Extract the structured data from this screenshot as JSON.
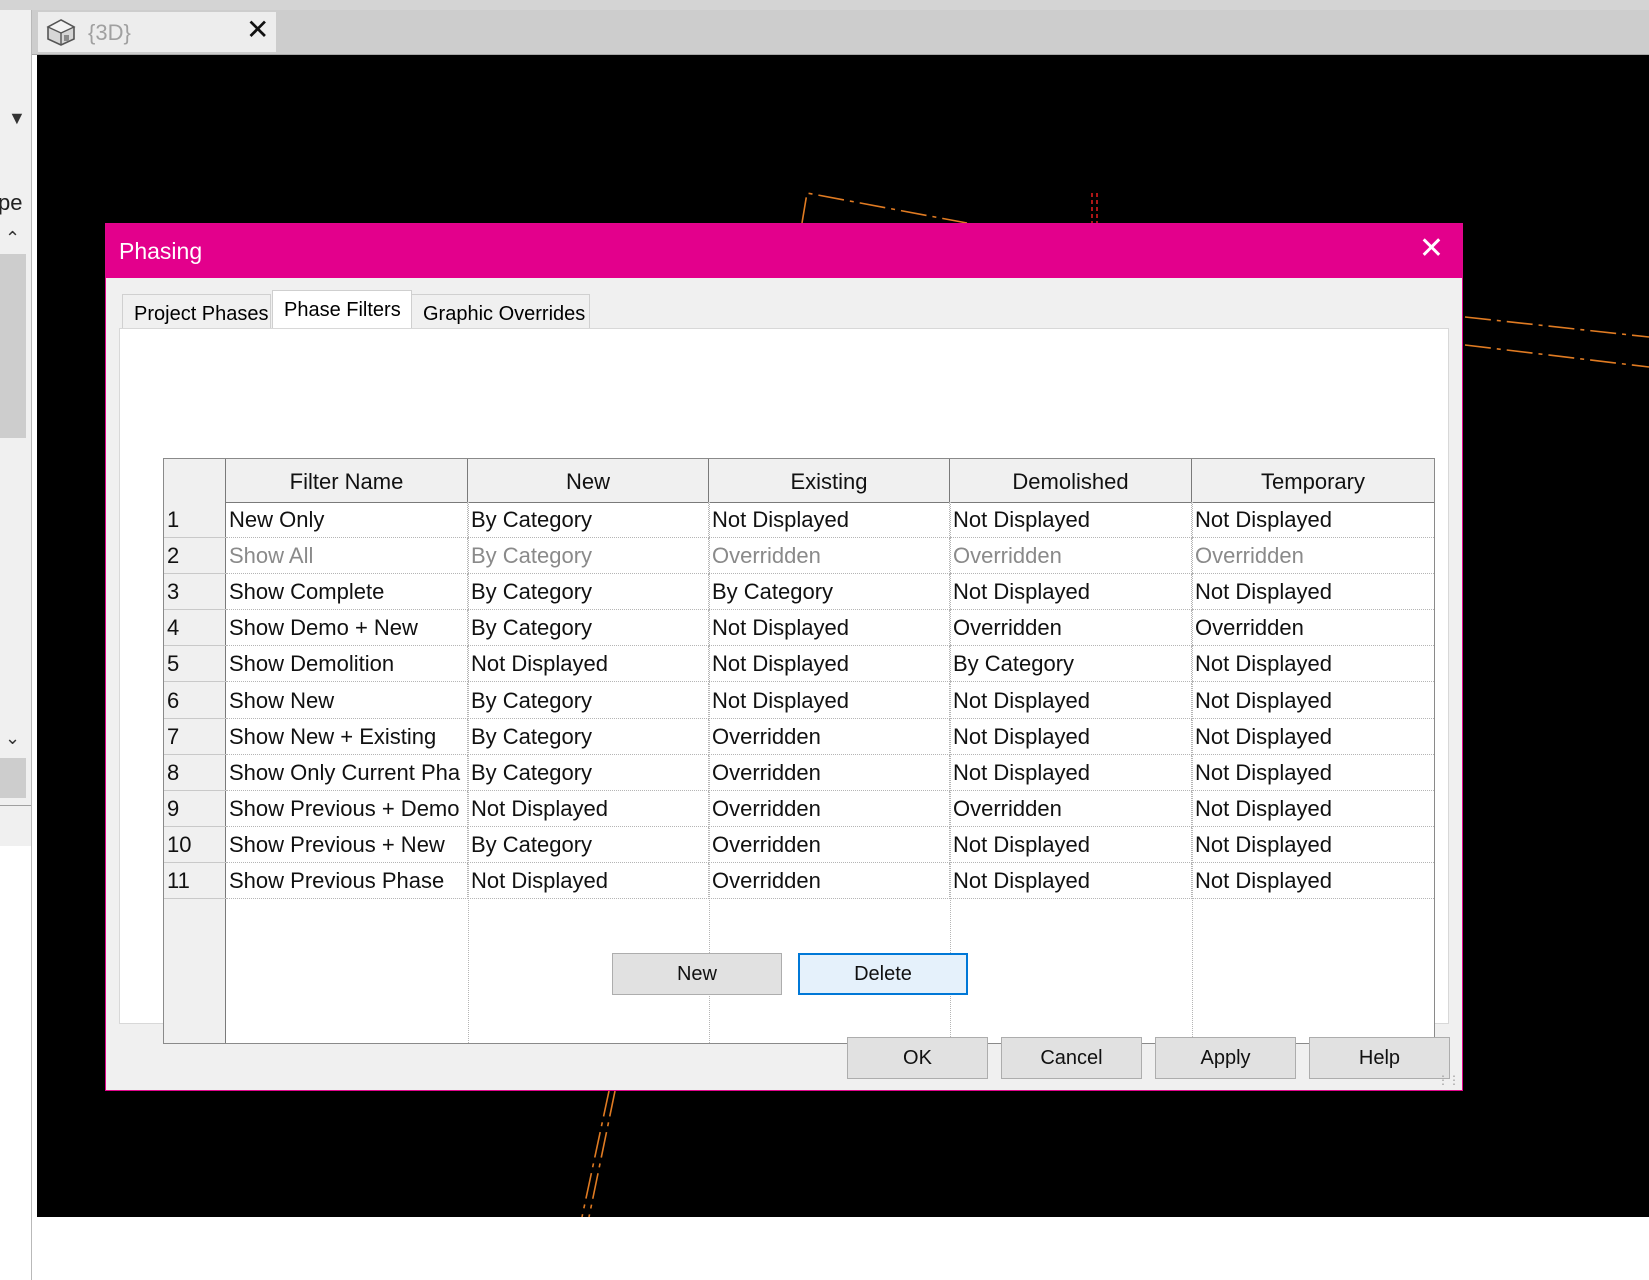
{
  "background": {
    "left_panel_label": "pe",
    "view_tab_label": "{3D}",
    "icons": {
      "left_dropdown": "triangle-down-icon",
      "left_scroll_up": "chevron-up-icon",
      "left_scroll_down": "chevron-down-icon",
      "view_icon": "3d-house-icon",
      "view_close": "close-icon"
    }
  },
  "dialog": {
    "title": "Phasing",
    "close_icon": "close-icon",
    "accent_color": "#e3008c",
    "tabs": [
      {
        "label": "Project Phases",
        "active": false
      },
      {
        "label": "Phase Filters",
        "active": true
      },
      {
        "label": "Graphic Overrides",
        "active": false
      }
    ],
    "table": {
      "columns": [
        "Filter Name",
        "New",
        "Existing",
        "Demolished",
        "Temporary"
      ],
      "rows": [
        {
          "num": "1",
          "cells": [
            "New Only",
            "By Category",
            "Not Displayed",
            "Not Displayed",
            "Not Displayed"
          ],
          "dimmed": false
        },
        {
          "num": "2",
          "cells": [
            "Show All",
            "By Category",
            "Overridden",
            "Overridden",
            "Overridden"
          ],
          "dimmed": true
        },
        {
          "num": "3",
          "cells": [
            "Show Complete",
            "By Category",
            "By Category",
            "Not Displayed",
            "Not Displayed"
          ],
          "dimmed": false
        },
        {
          "num": "4",
          "cells": [
            "Show Demo + New",
            "By Category",
            "Not Displayed",
            "Overridden",
            "Overridden"
          ],
          "dimmed": false
        },
        {
          "num": "5",
          "cells": [
            "Show Demolition",
            "Not Displayed",
            "Not Displayed",
            "By Category",
            "Not Displayed"
          ],
          "dimmed": false
        },
        {
          "num": "6",
          "cells": [
            "Show New",
            "By Category",
            "Not Displayed",
            "Not Displayed",
            "Not Displayed"
          ],
          "dimmed": false
        },
        {
          "num": "7",
          "cells": [
            "Show New + Existing",
            "By Category",
            "Overridden",
            "Not Displayed",
            "Not Displayed"
          ],
          "dimmed": false
        },
        {
          "num": "8",
          "cells": [
            "Show Only Current Pha",
            "By Category",
            "Overridden",
            "Not Displayed",
            "Not Displayed"
          ],
          "dimmed": false
        },
        {
          "num": "9",
          "cells": [
            "Show Previous + Demo",
            "Not Displayed",
            "Overridden",
            "Overridden",
            "Not Displayed"
          ],
          "dimmed": false
        },
        {
          "num": "10",
          "cells": [
            "Show Previous + New",
            "By Category",
            "Overridden",
            "Not Displayed",
            "Not Displayed"
          ],
          "dimmed": false
        },
        {
          "num": "11",
          "cells": [
            "Show Previous Phase",
            "Not Displayed",
            "Overridden",
            "Not Displayed",
            "Not Displayed"
          ],
          "dimmed": false
        }
      ]
    },
    "grid_buttons": {
      "new": "New",
      "delete": "Delete"
    },
    "footer_buttons": {
      "ok": "OK",
      "cancel": "Cancel",
      "apply": "Apply",
      "help": "Help"
    }
  }
}
